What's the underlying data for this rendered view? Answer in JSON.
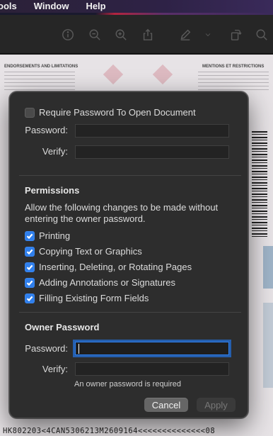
{
  "menubar": {
    "items": [
      "ools",
      "Window",
      "Help"
    ]
  },
  "toolbar": {
    "icons": [
      "info-icon",
      "zoom-out-icon",
      "zoom-in-icon",
      "share-icon",
      "markup-pen-icon",
      "chevron-down-icon",
      "rotate-icon",
      "search-icon"
    ]
  },
  "document": {
    "header_left": "ENDORSEMENTS AND LIMITATIONS",
    "header_right": "MENTIONS ET RESTRICTIONS",
    "mrz_line": "HK802203<4CAN5306213M2609164<<<<<<<<<<<<<<08"
  },
  "dialog": {
    "require_password": {
      "label": "Require Password To Open Document",
      "checked": false
    },
    "open_password": {
      "password_label": "Password:",
      "password_value": "",
      "verify_label": "Verify:",
      "verify_value": ""
    },
    "permissions": {
      "title": "Permissions",
      "description": "Allow the following changes to be made without entering the owner password.",
      "items": [
        {
          "label": "Printing",
          "checked": true
        },
        {
          "label": "Copying Text or Graphics",
          "checked": true
        },
        {
          "label": "Inserting, Deleting, or Rotating Pages",
          "checked": true
        },
        {
          "label": "Adding Annotations or Signatures",
          "checked": true
        },
        {
          "label": "Filling Existing Form Fields",
          "checked": true
        }
      ]
    },
    "owner": {
      "title": "Owner Password",
      "password_label": "Password:",
      "password_value": "",
      "verify_label": "Verify:",
      "verify_value": "",
      "hint": "An owner password is required"
    },
    "buttons": {
      "cancel": "Cancel",
      "apply": "Apply"
    }
  },
  "colors": {
    "accent": "#2f7fec",
    "dialog_bg": "#2d2d2d",
    "menubar_bg": "#2e2246"
  }
}
